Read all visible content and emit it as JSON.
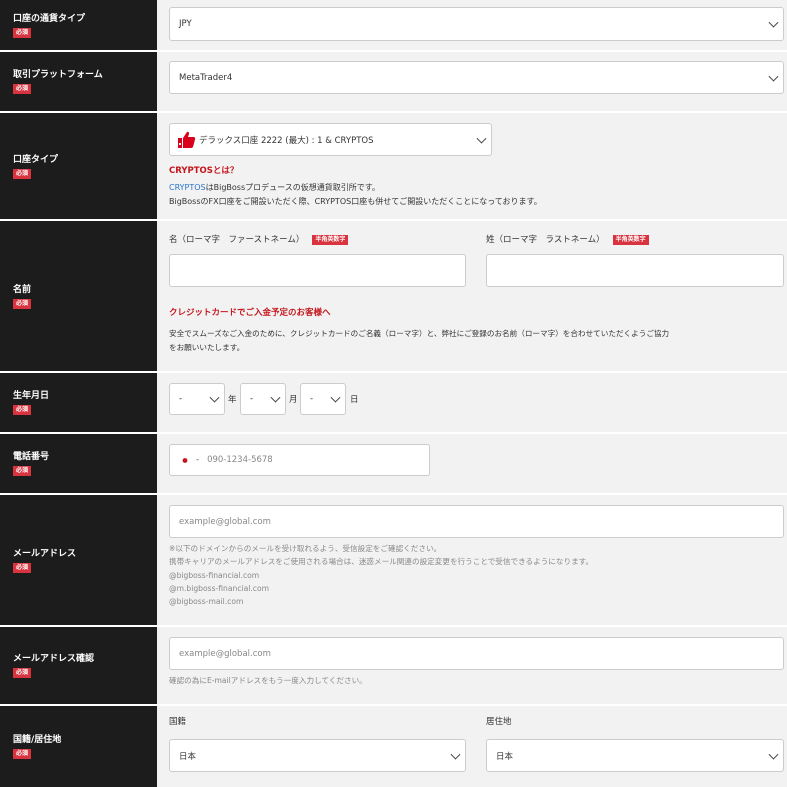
{
  "required_badge": "必須",
  "rows": {
    "currency": {
      "label": "口座の通貨タイプ",
      "value": "JPY"
    },
    "platform": {
      "label": "取引プラットフォーム",
      "value": "MetaTrader4"
    },
    "account_type": {
      "label": "口座タイプ",
      "value": "デラックス口座 2222 (最大) : 1 & CRYPTOS",
      "info_title": "CRYPTOSとは？",
      "info_link": "CRYPTOS",
      "info_line1_rest": "はBigBossプロデュースの仮想通貨取引所です。",
      "info_line2": "BigBossのFX口座をご開設いただく際、CRYPTOS口座も併せてご開設いただくことになっております。"
    },
    "name": {
      "label": "名前",
      "first_label": "名（ローマ字　ファーストネーム）",
      "last_label": "姓（ローマ字　ラストネーム）",
      "half_width_badge": "半角英数字",
      "notice_title": "クレジットカードでご入金予定のお客様へ",
      "notice_line1": "安全でスムーズなご入金のために、クレジットカードのご名義（ローマ字）と、弊社にご登録のお名前（ローマ字）を合わせていただくようご協力",
      "notice_line2": "をお願いいたします。"
    },
    "birthdate": {
      "label": "生年月日",
      "year_value": "-",
      "year_unit": "年",
      "month_value": "-",
      "month_unit": "月",
      "day_value": "-",
      "day_unit": "日"
    },
    "phone": {
      "label": "電話番号",
      "prefix": "-",
      "placeholder": "090-1234-5678"
    },
    "email": {
      "label": "メールアドレス",
      "placeholder": "example@global.com",
      "note1": "※以下のドメインからのメールを受け取れるよう、受信設定をご確認ください。",
      "note2": "携帯キャリアのメールアドレスをご使用される場合は、迷惑メール関連の設定変更を行うことで受信できるようになります。",
      "domains": [
        "@bigboss-financial.com",
        "@m.bigboss-financial.com",
        "@bigboss-mail.com"
      ]
    },
    "email_confirm": {
      "label": "メールアドレス確認",
      "placeholder": "example@global.com",
      "note": "確認の為にE-mailアドレスをもう一度入力してください。"
    },
    "nationality": {
      "label": "国籍/居住地",
      "nationality_label": "国籍",
      "nationality_value": "日本",
      "residence_label": "居住地",
      "residence_value": "日本"
    }
  },
  "colors": {
    "label_bg": "#1c1c1c",
    "badge": "#d9333f",
    "accent_red": "#c4161c",
    "link_blue": "#2a74c8"
  }
}
